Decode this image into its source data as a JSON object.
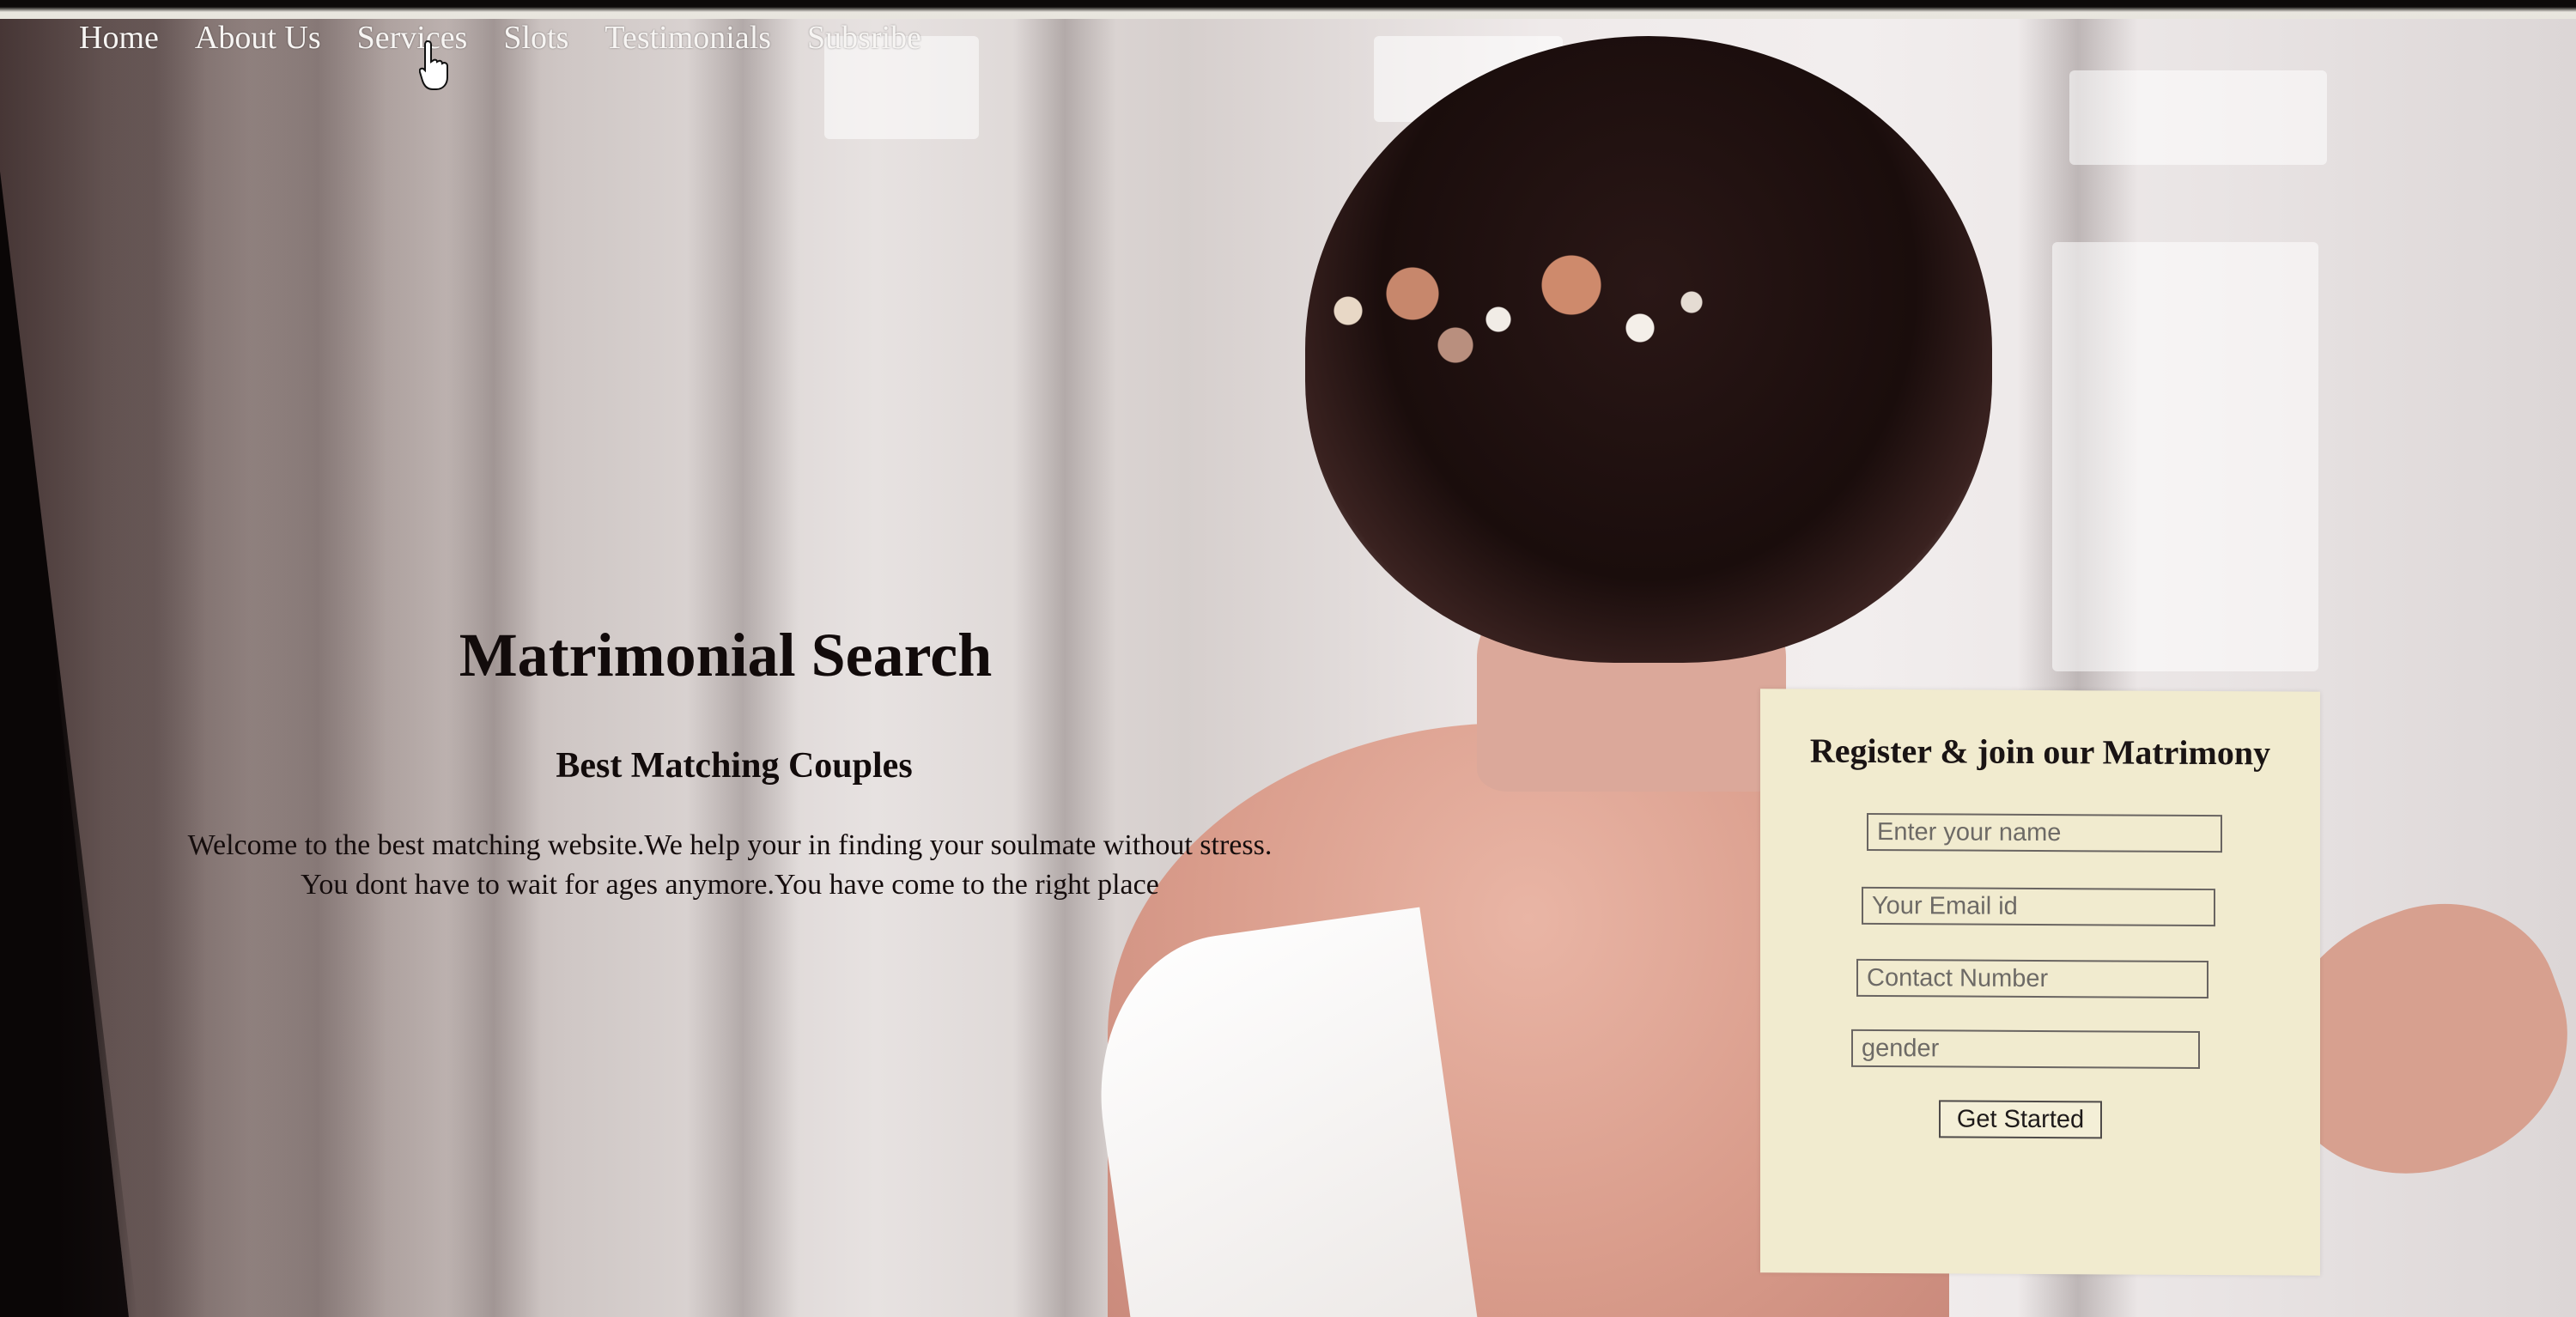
{
  "nav": {
    "items": [
      {
        "label": "Home"
      },
      {
        "label": "About Us"
      },
      {
        "label": "Services"
      },
      {
        "label": "Slots"
      },
      {
        "label": "Testimonials"
      },
      {
        "label": "Subsribe"
      }
    ]
  },
  "hero": {
    "title": "Matrimonial Search",
    "subtitle": "Best Matching Couples",
    "line1": "Welcome to the best matching website.We help your in finding your soulmate without stress.",
    "line2": "You dont have to wait for ages anymore.You have come to the right place"
  },
  "register": {
    "title": "Register & join our Matrimony",
    "name_placeholder": "Enter your name",
    "email_placeholder": "Your Email id",
    "contact_placeholder": "Contact Number",
    "gender_placeholder": "gender",
    "submit_label": "Get Started"
  },
  "colors": {
    "form_bg": "#f1ebcf",
    "nav_text": "#f7f5f3",
    "heading_text": "#120b0b"
  },
  "icons": {
    "cursor": "hand-pointer-icon"
  }
}
